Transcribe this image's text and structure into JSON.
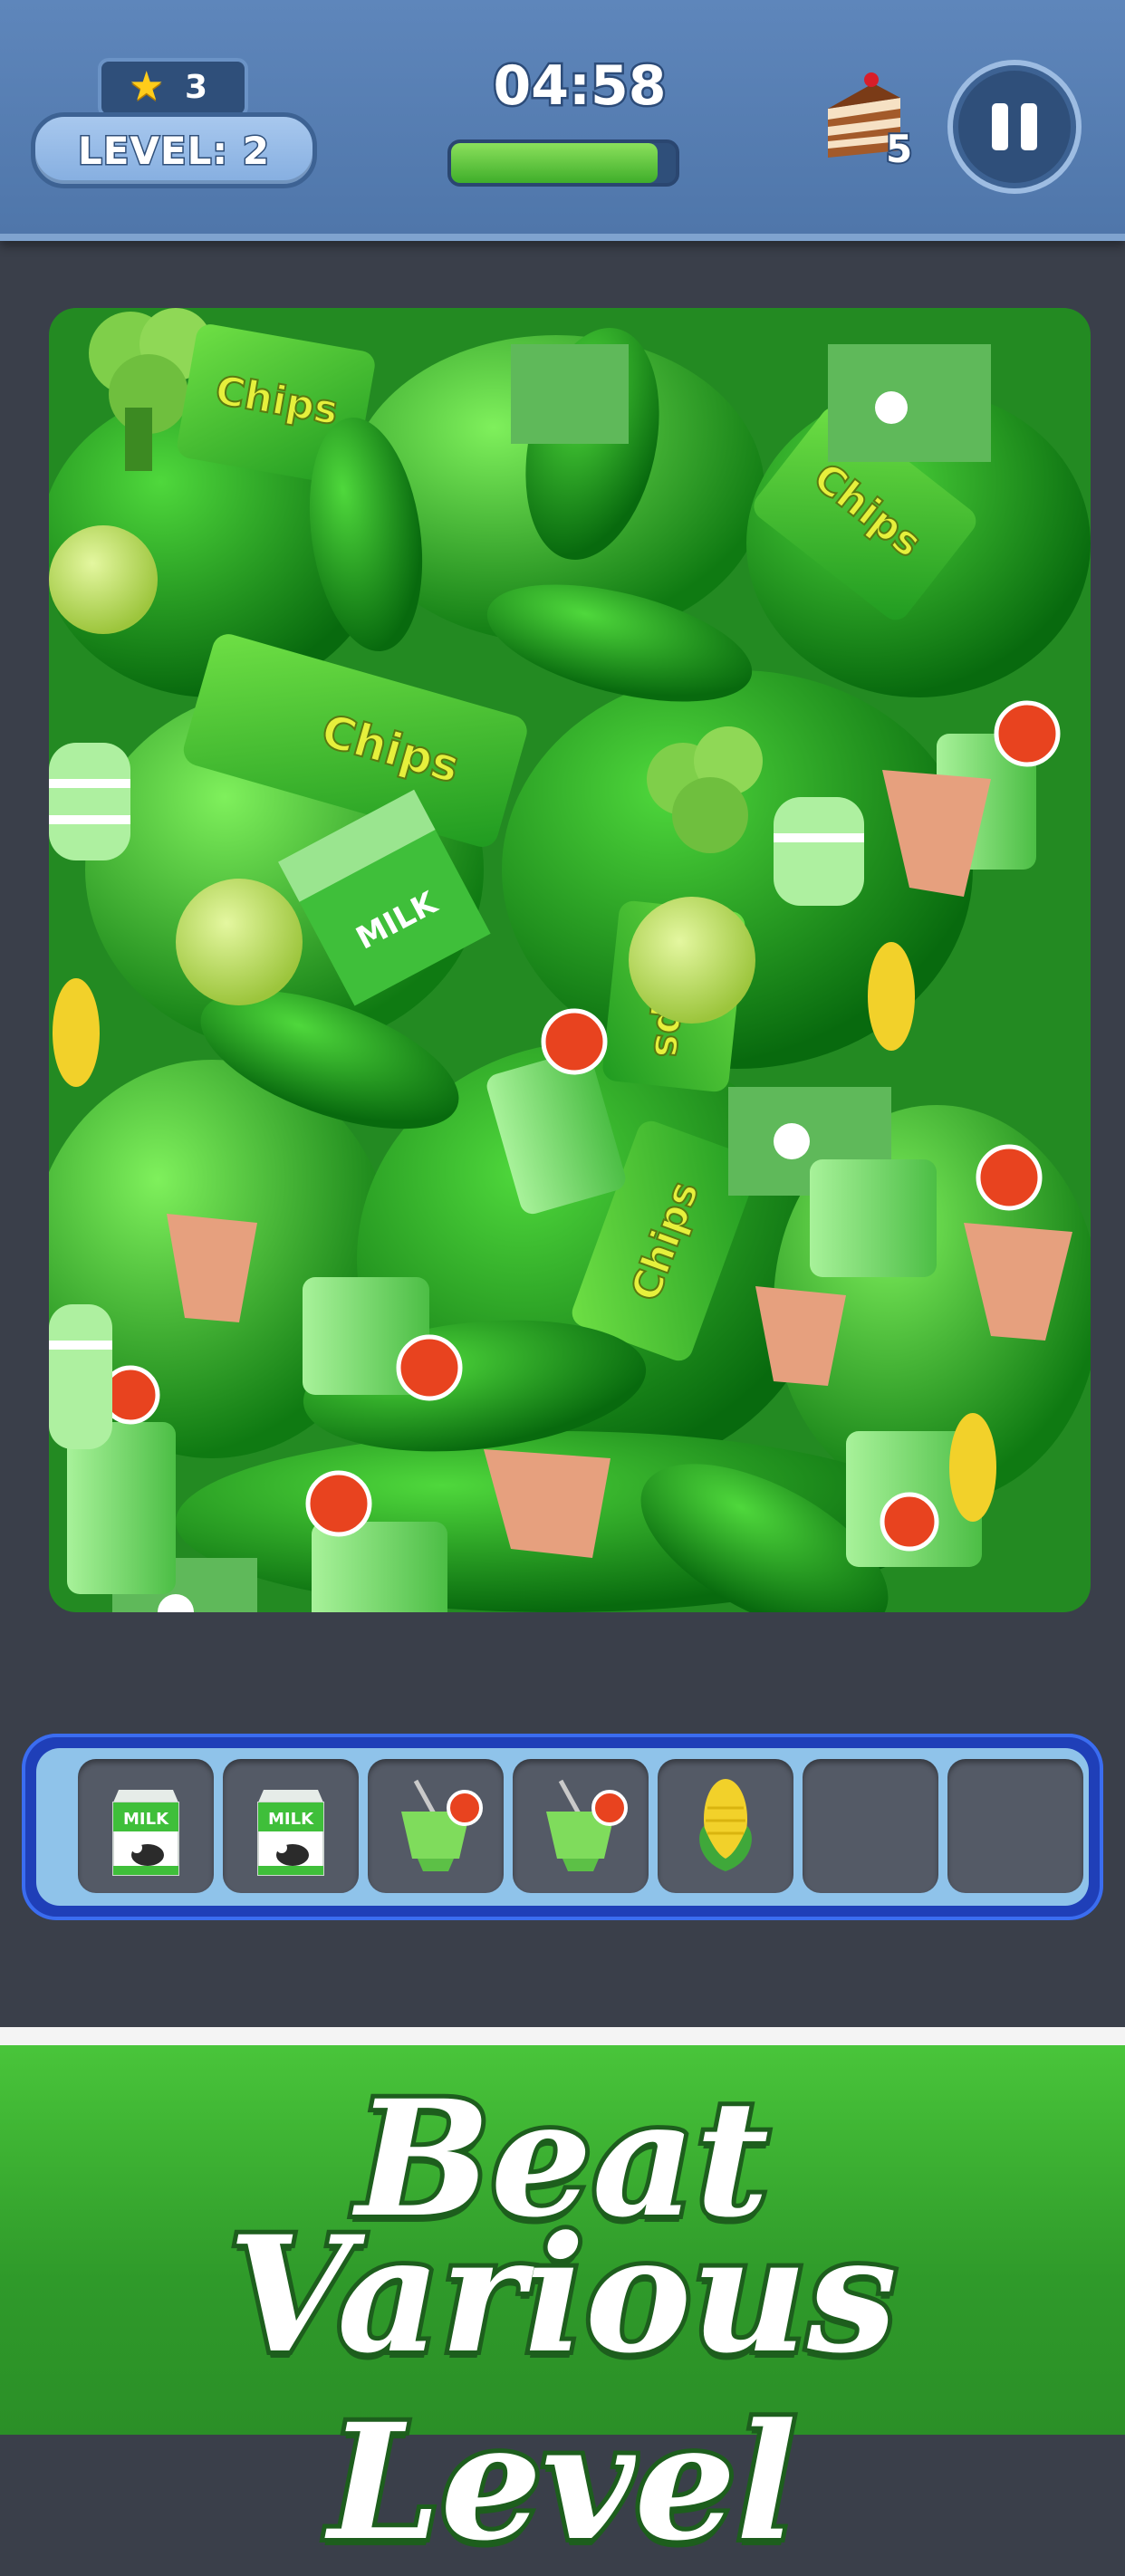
{
  "hud": {
    "stars": "3",
    "level": "LEVEL: 2",
    "timer": "04:58",
    "time_remaining_fraction": 0.92,
    "cake_count": "5",
    "pause_icon": "pause-icon",
    "star_icon": "star-icon",
    "cake_icon": "cake-icon"
  },
  "tray": {
    "slots": [
      {
        "item": "milk-carton"
      },
      {
        "item": "milk-carton"
      },
      {
        "item": "green-smoothie"
      },
      {
        "item": "green-smoothie"
      },
      {
        "item": "corn"
      },
      {
        "item": ""
      },
      {
        "item": ""
      }
    ],
    "milk_label": "MILK"
  },
  "pile": {
    "chips_label": "Chips",
    "milk_label": "MILK"
  },
  "banner": {
    "line1": "Beat",
    "line2": "Various Level"
  },
  "colors": {
    "hud": "#5e86bb",
    "tray": "#1f3fb8",
    "banner": "#3bb234"
  }
}
